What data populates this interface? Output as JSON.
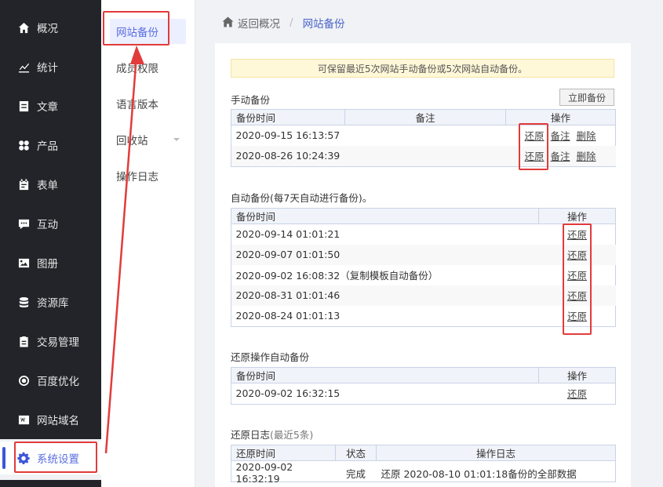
{
  "sidebar": {
    "items": [
      {
        "label": "概况",
        "icon": "home-icon"
      },
      {
        "label": "统计",
        "icon": "chart-icon"
      },
      {
        "label": "文章",
        "icon": "article-icon"
      },
      {
        "label": "产品",
        "icon": "product-icon"
      },
      {
        "label": "表单",
        "icon": "form-icon"
      },
      {
        "label": "互动",
        "icon": "chat-icon"
      },
      {
        "label": "图册",
        "icon": "gallery-icon"
      },
      {
        "label": "资源库",
        "icon": "database-icon"
      },
      {
        "label": "交易管理",
        "icon": "clipboard-icon"
      },
      {
        "label": "百度优化",
        "icon": "seo-icon"
      },
      {
        "label": "网站域名",
        "icon": "domain-icon"
      }
    ],
    "active": {
      "label": "系统设置",
      "icon": "gear-icon"
    }
  },
  "submenu": {
    "items": [
      "网站备份",
      "成员权限",
      "语言版本",
      "回收站",
      "操作日志"
    ]
  },
  "breadcrumb": {
    "back": "返回概况",
    "sep": "/",
    "current": "网站备份"
  },
  "notice": "可保留最近5次网站手动备份或5次网站自动备份。",
  "manual": {
    "title": "手动备份",
    "button": "立即备份",
    "headers": [
      "备份时间",
      "备注",
      "操作"
    ],
    "rows": [
      {
        "time": "2020-09-15 16:13:57",
        "note": "",
        "actions": [
          "还原",
          "备注",
          "删除"
        ]
      },
      {
        "time": "2020-08-26 10:24:39",
        "note": "",
        "actions": [
          "还原",
          "备注",
          "删除"
        ]
      }
    ]
  },
  "auto": {
    "title": "自动备份(每7天自动进行备份)。",
    "headers": [
      "备份时间",
      "操作"
    ],
    "rows": [
      {
        "time": "2020-09-14 01:01:21",
        "action": "还原"
      },
      {
        "time": "2020-09-07 01:01:50",
        "action": "还原"
      },
      {
        "time": "2020-09-02 16:08:32（复制模板自动备份）",
        "action": "还原"
      },
      {
        "time": "2020-08-31 01:01:46",
        "action": "还原"
      },
      {
        "time": "2020-08-24 01:01:13",
        "action": "还原"
      }
    ]
  },
  "restore_auto": {
    "title": "还原操作自动备份",
    "headers": [
      "备份时间",
      "操作"
    ],
    "rows": [
      {
        "time": "2020-09-02 16:32:15",
        "action": "还原"
      }
    ]
  },
  "restore_log": {
    "title": "还原日志",
    "title_suffix": "(最近5条)",
    "headers": [
      "还原时间",
      "状态",
      "操作日志"
    ],
    "rows": [
      {
        "time": "2020-09-02 16:32:19",
        "status": "完成",
        "log": "还原 2020-08-10 01:01:18备份的全部数据"
      }
    ]
  },
  "colors": {
    "accent": "#3d56d8",
    "highlight": "#e23b3b",
    "sidebar_bg": "#222429"
  }
}
